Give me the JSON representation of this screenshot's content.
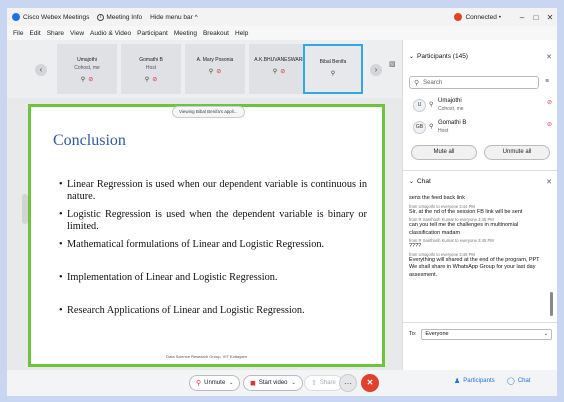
{
  "titlebar": {
    "app_title": "Cisco Webex Meetings",
    "meeting_info": "Meeting Info",
    "hide_menu": "Hide menu bar ^",
    "status": "Connected •",
    "min": "–",
    "max": "□",
    "close": "✕"
  },
  "menu": [
    "File",
    "Edit",
    "Share",
    "View",
    "Audio & Video",
    "Participant",
    "Meeting",
    "Breakout",
    "Help"
  ],
  "strip": {
    "prev": "‹",
    "next": "›",
    "tiles": [
      {
        "name": "Umajothi",
        "sub": "Cohost, me"
      },
      {
        "name": "Gomathi B",
        "sub": "Host"
      },
      {
        "name": "A. Mary Posonia",
        "sub": ""
      },
      {
        "name": "A.K.BHUVANESWARI",
        "sub": ""
      },
      {
        "name": "Bibal Benifa",
        "sub": ""
      }
    ]
  },
  "stage": {
    "viewing": "Viewing Bibal Benifa's appli...",
    "slide_title": "Conclusion",
    "bullets": [
      "Linear Regression is used when our dependent variable is continuous in nature.",
      "Logistic Regression is used when the dependent variable is binary or limited.",
      "Mathematical formulations of Linear and Logistic Regression.",
      "Implementation of Linear and Logistic Regression.",
      "Research Applications of Linear and Logistic Regression."
    ],
    "footer": "Data Science Research Group, VIT Kottayam"
  },
  "toolbar": {
    "unmute": "Unmute",
    "start_video": "Start video",
    "share": "Share",
    "more": "···",
    "leave": "✕",
    "participants": "Participants",
    "chat": "Chat"
  },
  "participants_panel": {
    "header": "Participants (145)",
    "search_placeholder": "Search",
    "list": [
      {
        "initials": "U",
        "name": "Umajothi",
        "role": "Cohost, me"
      },
      {
        "initials": "GB",
        "name": "Gomathi B",
        "role": "Host"
      }
    ],
    "mute_all": "Mute all",
    "unmute_all": "Unmute all"
  },
  "chat_panel": {
    "header": "Chat",
    "messages": [
      {
        "from": "",
        "text": "sens the feed back link"
      },
      {
        "from": "from Umajothi to everyone    3:44 PM",
        "text": "Sir, at the nd of the session FB link will be sent"
      },
      {
        "from": "from R Santhosh Kumar to everyone    3:45 PM",
        "text": "can you tell me the challenges in multinomial classification madam"
      },
      {
        "from": "from R Santhosh Kumar to everyone    3:45 PM",
        "text": "????"
      },
      {
        "from": "from Umajothi to everyone    3:45 PM",
        "text": "Everything will shared at the end of the program, PPT We shall share in WhatsApp Group for your last day assesment."
      }
    ],
    "to_label": "To:",
    "to_value": "Everyone"
  },
  "colors": {
    "accent": "#1c73e8",
    "share_border": "#6ec33d",
    "leave": "#e0412c",
    "connected": "#e1421f",
    "slide_title": "#2f5b9a"
  }
}
